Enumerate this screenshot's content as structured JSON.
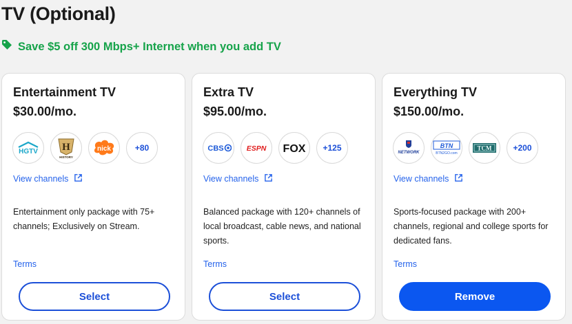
{
  "page": {
    "title": "TV (Optional)"
  },
  "promo": {
    "text": "Save $5 off 300 Mbps+ Internet when you add TV",
    "icon": "tag-icon",
    "color": "#16a34a"
  },
  "colors": {
    "link": "#2563eb",
    "primary_button": "#0b57f0",
    "outline_button": "#1b4fd8"
  },
  "cards": [
    {
      "name": "Entertainment TV",
      "price": "$30.00/mo.",
      "logos": [
        {
          "name": "HGTV",
          "text": "HGTV"
        },
        {
          "name": "History",
          "text": "H",
          "subtext": "HISTORY"
        },
        {
          "name": "Nick",
          "text": "nick"
        }
      ],
      "more_channels": "+80",
      "view_channels": "View channels",
      "description": "Entertainment only package with 75+ channels; Exclusively on Stream.",
      "terms": "Terms",
      "button": {
        "label": "Select",
        "style": "outline"
      }
    },
    {
      "name": "Extra TV",
      "price": "$95.00/mo.",
      "logos": [
        {
          "name": "CBS",
          "text": "CBS"
        },
        {
          "name": "ESPN",
          "text": "ESPN"
        },
        {
          "name": "FOX",
          "text": "FOX"
        }
      ],
      "more_channels": "+125",
      "view_channels": "View channels",
      "description": "Balanced package with 120+ channels of local broadcast, cable news, and national sports.",
      "terms": "Terms",
      "button": {
        "label": "Select",
        "style": "outline"
      }
    },
    {
      "name": "Everything TV",
      "price": "$150.00/mo.",
      "logos": [
        {
          "name": "NFL Network",
          "text": "NETWORK"
        },
        {
          "name": "BTN",
          "text": "BTN",
          "subtext": "BTN2GO.com"
        },
        {
          "name": "TCM",
          "text": "TCM"
        }
      ],
      "more_channels": "+200",
      "view_channels": "View channels",
      "description": "Sports-focused package with 200+ channels, regional and college sports for dedicated fans.",
      "terms": "Terms",
      "button": {
        "label": "Remove",
        "style": "filled"
      }
    }
  ]
}
